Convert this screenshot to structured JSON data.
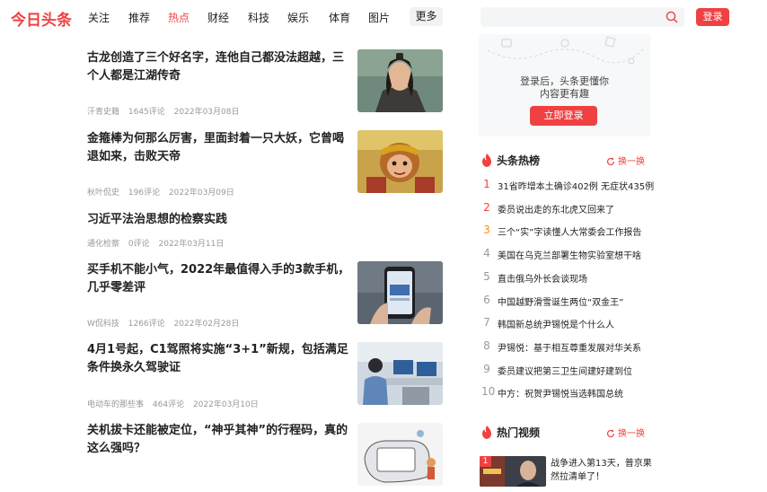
{
  "header": {
    "logo": "今日头条",
    "nav": [
      "关注",
      "推荐",
      "热点",
      "财经",
      "科技",
      "娱乐",
      "体育",
      "图片"
    ],
    "active_nav": "热点",
    "more_label": "更多",
    "search": {
      "value": "",
      "placeholder": ""
    },
    "login_label": "登录"
  },
  "feed": [
    {
      "title": "古龙创造了三个好名字，连他自己都没法超越，三个人都是江湖传奇",
      "source": "汗青史籍",
      "comments": "1645评论",
      "date": "2022年03月08日",
      "thumbnail": "man-in-ancient-costume"
    },
    {
      "title": "金箍棒为何那么厉害，里面封着一只大妖，它曾喝退如来，击败天帝",
      "source": "秋叶侃史",
      "comments": "196评论",
      "date": "2022年03月09日",
      "thumbnail": "monkey-king"
    },
    {
      "title": "习近平法治思想的检察实践",
      "source": "通化检察",
      "comments": "0评论",
      "date": "2022年03月11日"
    },
    {
      "title": "买手机不能小气，2022年最值得入手的3款手机，几乎零差评",
      "source": "W侃科技",
      "comments": "1266评论",
      "date": "2022年02月28日",
      "thumbnail": "smartphone-in-hand"
    },
    {
      "title": "4月1号起，C1驾照将实施“3+1”新规，包括满足条件换永久驾驶证",
      "source": "电动车的那些事",
      "comments": "464评论",
      "date": "2022年03月10日",
      "thumbnail": "police-office"
    },
    {
      "title": "关机拔卡还能被定位，“神乎其神”的行程码，真的这么强吗？",
      "source": "",
      "comments": "",
      "date": "",
      "thumbnail": "cartoon-phone"
    }
  ],
  "sidebar": {
    "login_card": {
      "line1": "登录后，头条更懂你",
      "line2": "内容更有趣",
      "button": "立即登录"
    },
    "hot_list": {
      "title": "头条热榜",
      "refresh": "换一换",
      "items": [
        {
          "rank": "1",
          "text": "31省昨增本土确诊402例 无症状435例"
        },
        {
          "rank": "2",
          "text": "委员说出走的东北虎又回来了"
        },
        {
          "rank": "3",
          "text": "三个“实”字读懂人大常委会工作报告"
        },
        {
          "rank": "4",
          "text": "美国在乌克兰部署生物实验室想干啥"
        },
        {
          "rank": "5",
          "text": "直击俄乌外长会谈现场"
        },
        {
          "rank": "6",
          "text": "中国越野滑雪诞生两位“双金王”"
        },
        {
          "rank": "7",
          "text": "韩国新总统尹锡悦是个什么人"
        },
        {
          "rank": "8",
          "text": "尹锡悦：基于相互尊重发展对华关系"
        },
        {
          "rank": "9",
          "text": "委员建议把第三卫生间建好建到位"
        },
        {
          "rank": "10",
          "text": "中方：祝贺尹锡悦当选韩国总统"
        }
      ],
      "rank_colors": [
        "#f04142",
        "#f04142",
        "#ff8f0e"
      ]
    },
    "hot_video": {
      "title": "热门视频",
      "refresh": "换一换",
      "item": {
        "rank": "1",
        "title": "战争进入第13天，普京果然拉清单了！"
      }
    }
  },
  "colors": {
    "accent": "#f04142",
    "rank_third": "#ff8f0e",
    "meta_gray": "#999999"
  }
}
